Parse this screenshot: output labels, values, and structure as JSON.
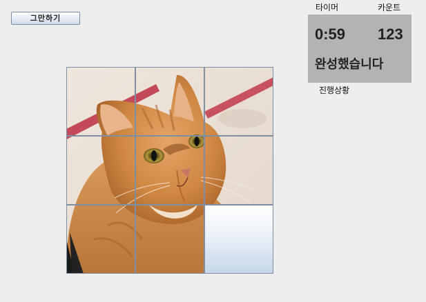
{
  "controls": {
    "quit_label": "그만하기"
  },
  "status": {
    "timer_label": "타이머",
    "count_label": "카운트",
    "timer_value": "0:59",
    "count_value": "123",
    "message": "완성했습니다",
    "progress_label": "진행상황"
  },
  "puzzle": {
    "image_subject": "orange-tabby-cat",
    "rows": 3,
    "cols": 3,
    "empty_tile": 9,
    "colors": {
      "tile_border": "#7f8fa3",
      "panel_bg": "#b3b3b3",
      "window_bg": "#eeeeee"
    }
  }
}
